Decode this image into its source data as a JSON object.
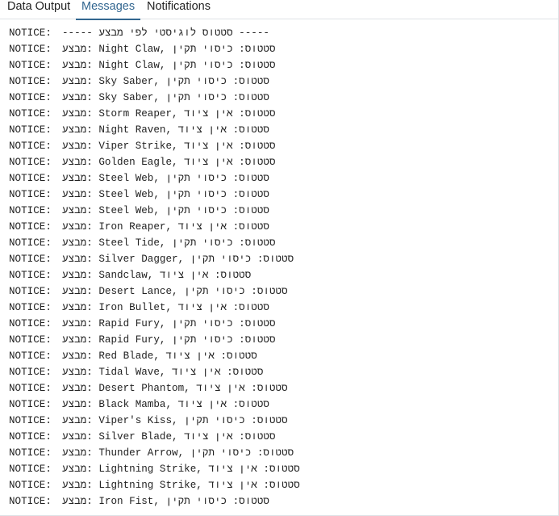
{
  "tabs": [
    {
      "label": "Data Output",
      "active": false
    },
    {
      "label": "Messages",
      "active": true
    },
    {
      "label": "Notifications",
      "active": false
    }
  ],
  "messages": [
    {
      "level": "NOTICE:",
      "text": "----- סטטוס לוגיסטי לפי מבצע -----"
    },
    {
      "level": "NOTICE:",
      "text": "מבצע: Night Claw, סטטוס: כיסוי תקין"
    },
    {
      "level": "NOTICE:",
      "text": "מבצע: Night Claw, סטטוס: כיסוי תקין"
    },
    {
      "level": "NOTICE:",
      "text": "מבצע: Sky Saber, סטטוס: כיסוי תקין"
    },
    {
      "level": "NOTICE:",
      "text": "מבצע: Sky Saber, סטטוס: כיסוי תקין"
    },
    {
      "level": "NOTICE:",
      "text": "מבצע: Storm Reaper, סטטוס: אין ציוד"
    },
    {
      "level": "NOTICE:",
      "text": "מבצע: Night Raven, סטטוס: אין ציוד"
    },
    {
      "level": "NOTICE:",
      "text": "מבצע: Viper Strike, סטטוס: אין ציוד"
    },
    {
      "level": "NOTICE:",
      "text": "מבצע: Golden Eagle, סטטוס: אין ציוד"
    },
    {
      "level": "NOTICE:",
      "text": "מבצע: Steel Web, סטטוס: כיסוי תקין"
    },
    {
      "level": "NOTICE:",
      "text": "מבצע: Steel Web, סטטוס: כיסוי תקין"
    },
    {
      "level": "NOTICE:",
      "text": "מבצע: Steel Web, סטטוס: כיסוי תקין"
    },
    {
      "level": "NOTICE:",
      "text": "מבצע: Iron Reaper, סטטוס: אין ציוד"
    },
    {
      "level": "NOTICE:",
      "text": "מבצע: Steel Tide, סטטוס: כיסוי תקין"
    },
    {
      "level": "NOTICE:",
      "text": "מבצע: Silver Dagger, סטטוס: כיסוי תקין"
    },
    {
      "level": "NOTICE:",
      "text": "מבצע: Sandclaw, סטטוס: אין ציוד"
    },
    {
      "level": "NOTICE:",
      "text": "מבצע: Desert Lance, סטטוס: כיסוי תקין"
    },
    {
      "level": "NOTICE:",
      "text": "מבצע: Iron Bullet, סטטוס: אין ציוד"
    },
    {
      "level": "NOTICE:",
      "text": "מבצע: Rapid Fury, סטטוס: כיסוי תקין"
    },
    {
      "level": "NOTICE:",
      "text": "מבצע: Rapid Fury, סטטוס: כיסוי תקין"
    },
    {
      "level": "NOTICE:",
      "text": "מבצע: Red Blade, סטטוס: אין ציוד"
    },
    {
      "level": "NOTICE:",
      "text": "מבצע: Tidal Wave, סטטוס: אין ציוד"
    },
    {
      "level": "NOTICE:",
      "text": "מבצע: Desert Phantom, סטטוס: אין ציוד"
    },
    {
      "level": "NOTICE:",
      "text": "מבצע: Black Mamba, סטטוס: אין ציוד"
    },
    {
      "level": "NOTICE:",
      "text": "מבצע: Viper's Kiss, סטטוס: כיסוי תקין"
    },
    {
      "level": "NOTICE:",
      "text": "מבצע: Silver Blade, סטטוס: אין ציוד"
    },
    {
      "level": "NOTICE:",
      "text": "מבצע: Thunder Arrow, סטטוס: כיסוי תקין"
    },
    {
      "level": "NOTICE:",
      "text": "מבצע: Lightning Strike, סטטוס: אין ציוד"
    },
    {
      "level": "NOTICE:",
      "text": "מבצע: Lightning Strike, סטטוס: אין ציוד"
    },
    {
      "level": "NOTICE:",
      "text": "מבצע: Iron Fist, סטטוס: כיסוי תקין"
    }
  ]
}
